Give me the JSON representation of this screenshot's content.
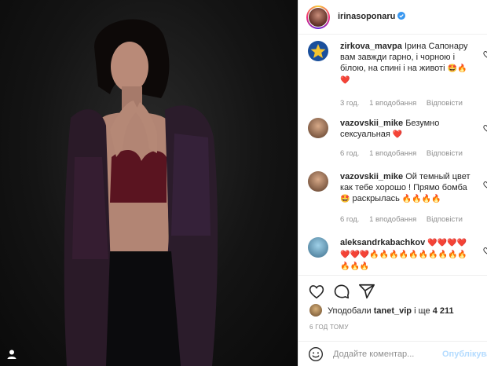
{
  "post": {
    "author": "irinasoponaru",
    "verified": true
  },
  "comments": [
    {
      "user": "zirkova_mavpa",
      "text": "Ірина Сапонару вам завжди гарно, і чорною і білою, на спині і на животі",
      "emoji": "🤩🔥",
      "hearts": "❤️",
      "time": "3 год.",
      "likes": "1 вподобання",
      "reply": "Відповісти"
    },
    {
      "user": "vazovskii_mike",
      "text": "Безумно сексуальная",
      "hearts": "❤️",
      "time": "6 год.",
      "likes": "1 вподобання",
      "reply": "Відповісти"
    },
    {
      "user": "vazovskii_mike",
      "text": "Ой темный цвет как тебе хорошо ! Прямо бомба",
      "emoji_line": "🤩",
      "text2": "раскрылась",
      "fire": "🔥🔥🔥🔥",
      "time": "6 год.",
      "likes": "1 вподобання",
      "reply": "Відповісти"
    },
    {
      "user": "aleksandrkabachkov",
      "hearts_a": "❤️❤️❤️❤️",
      "hearts_b": "❤️❤️❤️",
      "fire": "🔥🔥🔥🔥🔥🔥🔥🔥🔥🔥🔥🔥🔥"
    }
  ],
  "likes_line": {
    "prefix": "Уподобали",
    "user": "tanet_vip",
    "suffix": "і ще",
    "count": "4 211"
  },
  "time_ago": "6 ГОД ТОМУ",
  "add_comment": {
    "placeholder": "Додайте коментар...",
    "post_label": "Опублікувати"
  },
  "colors": {
    "verified": "#3897f0",
    "heart_red": "#ed4956",
    "meta_gray": "#8e8e8e",
    "post_disabled": "#b3dbff"
  }
}
